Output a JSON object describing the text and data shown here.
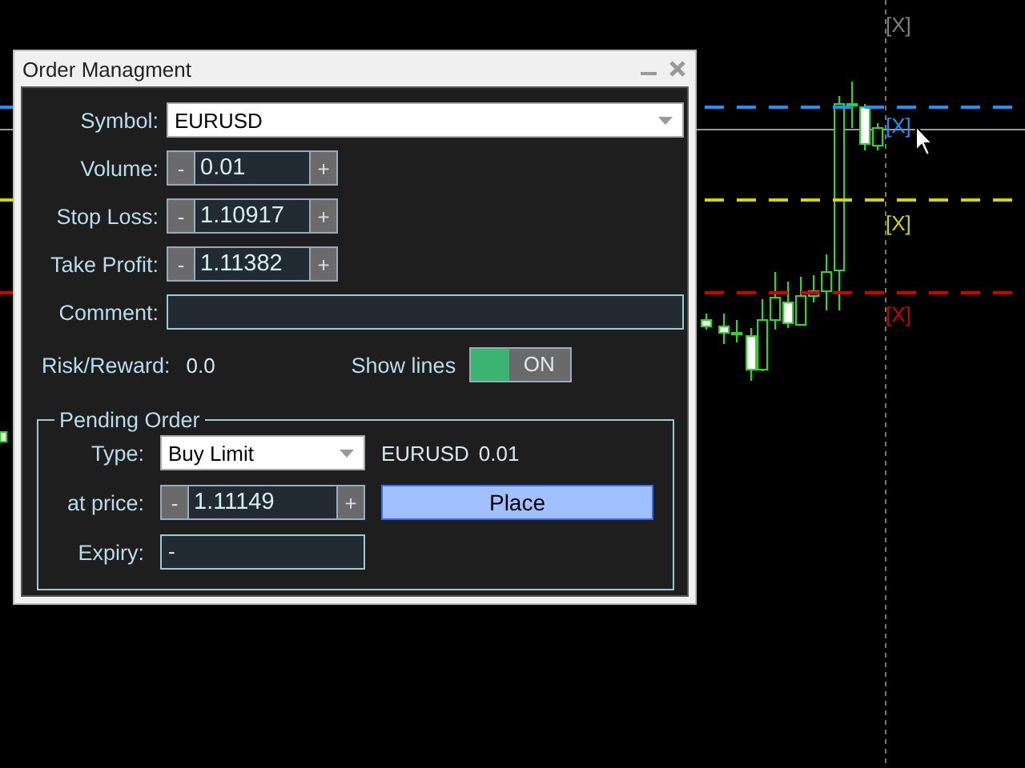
{
  "chart": {
    "markers": [
      {
        "label": "[X]",
        "color": "#808080",
        "kind": "none"
      },
      {
        "label": "[X]",
        "color": "#1e90ff",
        "kind": "dashed"
      },
      {
        "label": "[X]",
        "color": "#d4d400",
        "kind": "dashed"
      },
      {
        "label": "[X]",
        "color": "#d00000",
        "kind": "dashed"
      }
    ]
  },
  "window": {
    "title": "Order Managment"
  },
  "fields": [
    {
      "kind": "dropdown",
      "label": "Symbol:",
      "value": "EURUSD"
    },
    {
      "kind": "stepper",
      "label": "Volume:",
      "minus": "-",
      "value": "0.01",
      "plus": "+"
    },
    {
      "kind": "stepper",
      "label": "Stop Loss:",
      "minus": "-",
      "value": "1.10917",
      "plus": "+"
    },
    {
      "kind": "stepper",
      "label": "Take Profit:",
      "minus": "-",
      "value": "1.11382",
      "plus": "+"
    },
    {
      "kind": "text",
      "label": "Comment:"
    }
  ],
  "risk": {
    "label": "Risk/Reward:",
    "value": "0.0"
  },
  "show_lines": {
    "label": "Show lines",
    "on": true,
    "state_text": "ON"
  },
  "pending": {
    "title": "Pending Order",
    "type": {
      "label": "Type:",
      "value": "Buy Limit"
    },
    "summary": [
      "EURUSD",
      "0.01"
    ],
    "price": {
      "label": "at price:",
      "minus": "-",
      "value": "1.11149",
      "plus": "+"
    },
    "place_button": "Place",
    "expiry": {
      "label": "Expiry:",
      "value": "-"
    }
  }
}
